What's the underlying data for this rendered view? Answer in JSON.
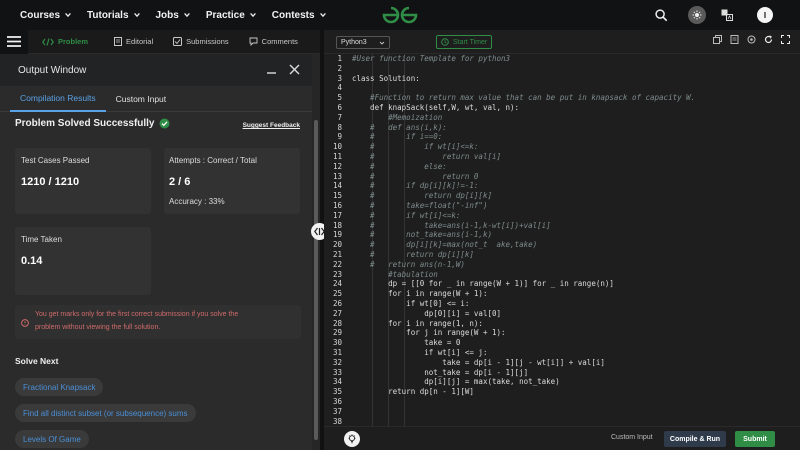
{
  "nav": {
    "items": [
      "Courses",
      "Tutorials",
      "Jobs",
      "Practice",
      "Contests"
    ],
    "avatar_letter": "I"
  },
  "left_tabs": {
    "problem": "Problem",
    "editorial": "Editorial",
    "submissions": "Submissions",
    "comments": "Comments"
  },
  "output_window": {
    "title": "Output Window",
    "tab_results": "Compilation Results",
    "tab_custom": "Custom Input",
    "status": "Problem Solved Successfully",
    "feedback": "Suggest Feedback",
    "test_cases_label": "Test Cases Passed",
    "test_cases_value": "1210 / 1210",
    "attempts_label": "Attempts : Correct / Total",
    "attempts_value": "2 / 6",
    "accuracy_label": "Accuracy :",
    "accuracy_value": "33%",
    "time_label": "Time Taken",
    "time_value": "0.14",
    "note_line1": "You get marks only for the first correct submission if you solve the",
    "note_line2": "problem without viewing the full solution.",
    "solve_next": "Solve Next",
    "next_items": [
      "Fractional Knapsack",
      "Find all distinct subset (or subsequence) sums",
      "Levels Of Game"
    ]
  },
  "editor_bar": {
    "language": "Python3",
    "timer": "Start Timer"
  },
  "bottom": {
    "custom_input": "Custom Input",
    "compile_run": "Compile & Run",
    "submit": "Submit"
  },
  "colors": {
    "accent_green": "#2f8d46",
    "link_blue": "#5aa2e6",
    "warning_red": "#d06b6b"
  },
  "code_lines": [
    {
      "n": "1",
      "t": "#User function Template for python3",
      "c": "cmt"
    },
    {
      "n": "2",
      "t": "",
      "c": ""
    },
    {
      "n": "3",
      "t": "class Solution:",
      "c": ""
    },
    {
      "n": "4",
      "t": "",
      "c": ""
    },
    {
      "n": "5",
      "t": "    #Function to return max value that can be put in knapsack of capacity W.",
      "c": "cmt"
    },
    {
      "n": "6",
      "t": "    def knapSack(self,W, wt, val, n):",
      "c": ""
    },
    {
      "n": "7",
      "t": "        #Memoization",
      "c": "cmt"
    },
    {
      "n": "8",
      "t": "    #   def ans(i,k):",
      "c": "cmt"
    },
    {
      "n": "9",
      "t": "    #       if i==0:",
      "c": "cmt"
    },
    {
      "n": "10",
      "t": "    #           if wt[i]<=k:",
      "c": "cmt"
    },
    {
      "n": "11",
      "t": "    #               return val[i]",
      "c": "cmt"
    },
    {
      "n": "12",
      "t": "    #           else:",
      "c": "cmt"
    },
    {
      "n": "13",
      "t": "    #               return 0",
      "c": "cmt"
    },
    {
      "n": "14",
      "t": "    #       if dp[i][k]!=-1:",
      "c": "cmt"
    },
    {
      "n": "15",
      "t": "    #           return dp[i][k]",
      "c": "cmt"
    },
    {
      "n": "16",
      "t": "    #       take=float(\"-inf\")",
      "c": "cmt"
    },
    {
      "n": "17",
      "t": "    #       if wt[i]<=k:",
      "c": "cmt"
    },
    {
      "n": "18",
      "t": "    #           take=ans(i-1,k-wt[i])+val[i]",
      "c": "cmt"
    },
    {
      "n": "19",
      "t": "    #       not_take=ans(i-1,k)",
      "c": "cmt"
    },
    {
      "n": "20",
      "t": "    #       dp[i][k]=max(not_t  ake,take)",
      "c": "cmt"
    },
    {
      "n": "21",
      "t": "    #       return dp[i][k]",
      "c": "cmt"
    },
    {
      "n": "22",
      "t": "    #   return ans(n-1,W)",
      "c": "cmt"
    },
    {
      "n": "23",
      "t": "        #tabulation",
      "c": "cmt"
    },
    {
      "n": "24",
      "t": "        dp = [[0 for _ in range(W + 1)] for _ in range(n)]",
      "c": ""
    },
    {
      "n": "25",
      "t": "        for i in range(W + 1):",
      "c": ""
    },
    {
      "n": "26",
      "t": "            if wt[0] <= i:",
      "c": ""
    },
    {
      "n": "27",
      "t": "                dp[0][i] = val[0]",
      "c": ""
    },
    {
      "n": "28",
      "t": "        for i in range(1, n):",
      "c": ""
    },
    {
      "n": "29",
      "t": "            for j in range(W + 1):",
      "c": ""
    },
    {
      "n": "30",
      "t": "                take = 0",
      "c": ""
    },
    {
      "n": "31",
      "t": "                if wt[i] <= j:",
      "c": ""
    },
    {
      "n": "32",
      "t": "                    take = dp[i - 1][j - wt[i]] + val[i]",
      "c": ""
    },
    {
      "n": "33",
      "t": "                not_take = dp[i - 1][j]",
      "c": ""
    },
    {
      "n": "34",
      "t": "                dp[i][j] = max(take, not_take)",
      "c": ""
    },
    {
      "n": "35",
      "t": "        return dp[n - 1][W]",
      "c": ""
    },
    {
      "n": "36",
      "t": "",
      "c": ""
    },
    {
      "n": "37",
      "t": "",
      "c": ""
    },
    {
      "n": "38",
      "t": "",
      "c": ""
    }
  ]
}
